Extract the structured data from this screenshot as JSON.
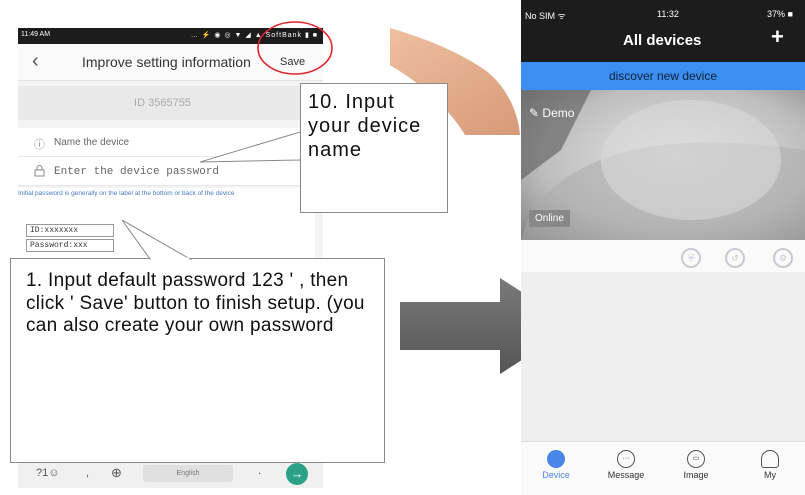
{
  "left_phone": {
    "status_time": "11:49 AM",
    "status_icons": "… ⚡ ◉ ◎ ▼ ◢ ▲ SoftBank ▮ ■",
    "back_label": "‹",
    "title": "Improve setting information",
    "save_label": "Save",
    "device_id": "ID 3565755",
    "name_field": {
      "icon": "info-circle-icon",
      "placeholder": "Name the device"
    },
    "password_field": {
      "icon": "lock-icon",
      "placeholder": "Enter the device password"
    },
    "hint": "Initial password is generally on the label at the bottom or back of the device",
    "sample_label": {
      "id_line": "ID:xxxxxxx",
      "password_line": "Password:xxx"
    },
    "keyboard": {
      "symbols": "?1☺",
      "comma": ",",
      "globe": "⊕",
      "space": "English",
      "dot": ".",
      "enter": "→"
    }
  },
  "callouts": {
    "step10": "10. Input your device name",
    "step1": "1.  Input  default password 123 ' , then click ' Save' button to finish setup. (you can also create your own password"
  },
  "right_phone": {
    "status_sim": "No SIM ᯤ",
    "status_time": "11:32",
    "status_battery": "37% ■",
    "title": "All devices",
    "add_label": "+",
    "banner": "discover new device",
    "camera_name": "Demo",
    "camera_status": "Online",
    "tools": [
      "shield-icon",
      "playback-icon",
      "settings-icon"
    ],
    "tabs": [
      {
        "label": "Device",
        "icon": "device-icon",
        "active": true
      },
      {
        "label": "Message",
        "icon": "message-icon",
        "active": false
      },
      {
        "label": "Image",
        "icon": "image-icon",
        "active": false
      },
      {
        "label": "My",
        "icon": "person-icon",
        "active": false
      }
    ]
  },
  "colors": {
    "accent": "#3d8ef3",
    "tab_active": "#4a86e8",
    "highlight_circle": "#e0262b",
    "arrow": "#666666",
    "keyboard_enter": "#2ba287"
  }
}
